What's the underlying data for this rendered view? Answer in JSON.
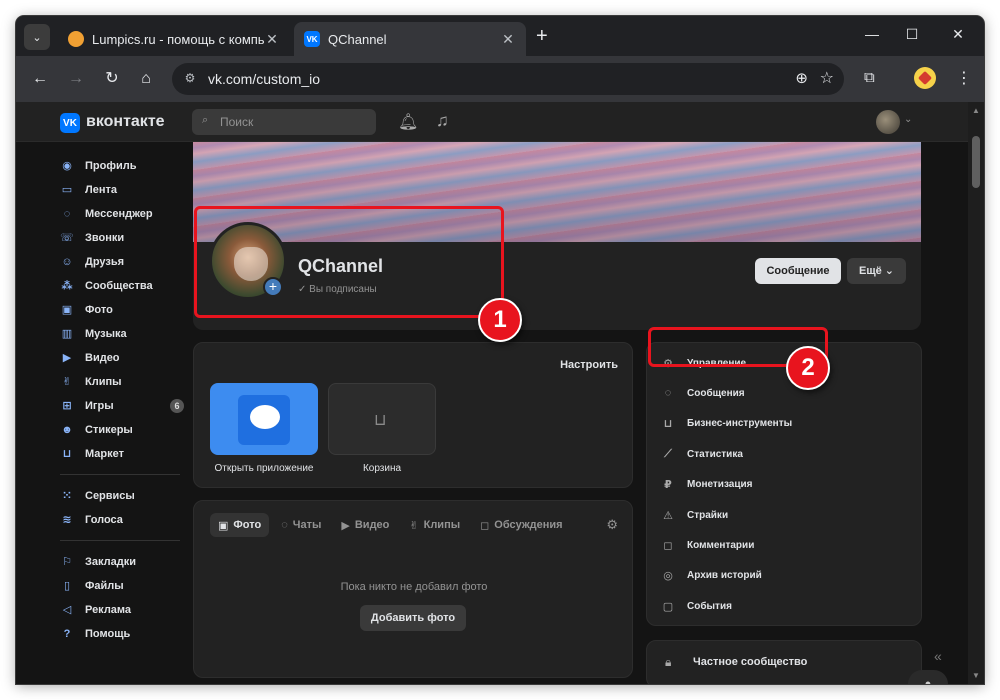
{
  "browser": {
    "tabs": [
      {
        "title": "Lumpics.ru - помощь с компь",
        "active": false
      },
      {
        "title": "QChannel",
        "active": true
      }
    ],
    "url": "vk.com/custom_io",
    "icons": {
      "tab_search": "chevron-down-icon",
      "new_tab": "plus-icon",
      "back": "arrow-left-icon",
      "forward": "arrow-right-icon",
      "reload": "reload-icon",
      "home": "home-icon",
      "zoom": "zoom-icon",
      "bookmark": "star-icon",
      "extensions": "puzzle-icon",
      "menu": "kebab-icon"
    }
  },
  "vk": {
    "brand": "вконтакте",
    "search_placeholder": "Поиск",
    "left_menu": [
      {
        "label": "Профиль",
        "icon": "user-icon"
      },
      {
        "label": "Лента",
        "icon": "feed-icon"
      },
      {
        "label": "Мессенджер",
        "icon": "chat-icon"
      },
      {
        "label": "Звонки",
        "icon": "phone-icon"
      },
      {
        "label": "Друзья",
        "icon": "friends-icon"
      },
      {
        "label": "Сообщества",
        "icon": "communities-icon"
      },
      {
        "label": "Фото",
        "icon": "photo-icon"
      },
      {
        "label": "Музыка",
        "icon": "music-icon"
      },
      {
        "label": "Видео",
        "icon": "video-icon"
      },
      {
        "label": "Клипы",
        "icon": "clips-icon"
      },
      {
        "label": "Игры",
        "icon": "games-icon",
        "badge": "6"
      },
      {
        "label": "Стикеры",
        "icon": "sticker-icon"
      },
      {
        "label": "Маркет",
        "icon": "market-icon"
      }
    ],
    "left_menu_2": [
      {
        "label": "Сервисы",
        "icon": "services-icon"
      },
      {
        "label": "Голоса",
        "icon": "votes-icon"
      }
    ],
    "left_menu_3": [
      {
        "label": "Закладки",
        "icon": "bookmark-icon"
      },
      {
        "label": "Файлы",
        "icon": "file-icon"
      },
      {
        "label": "Реклама",
        "icon": "ads-icon"
      },
      {
        "label": "Помощь",
        "icon": "help-icon"
      }
    ],
    "profile": {
      "name": "QChannel",
      "subscribed": "Вы подписаны",
      "message_button": "Сообщение",
      "more_button": "Ещё"
    },
    "apps": {
      "configure": "Настроить",
      "open_app": "Открыть приложение",
      "cart": "Корзина"
    },
    "photos": {
      "tabs": [
        "Фото",
        "Чаты",
        "Видео",
        "Клипы",
        "Обсуждения"
      ],
      "empty": "Пока никто не добавил фото",
      "add_button": "Добавить фото"
    },
    "management": [
      {
        "label": "Управление",
        "icon": "gear-icon"
      },
      {
        "label": "Сообщения",
        "icon": "chat-icon"
      },
      {
        "label": "Бизнес-инструменты",
        "icon": "bag-icon"
      },
      {
        "label": "Статистика",
        "icon": "chart-icon"
      },
      {
        "label": "Монетизация",
        "icon": "ruble-icon"
      },
      {
        "label": "Страйки",
        "icon": "warning-icon"
      },
      {
        "label": "Комментарии",
        "icon": "comment-icon"
      },
      {
        "label": "Архив историй",
        "icon": "archive-icon"
      },
      {
        "label": "События",
        "icon": "event-icon"
      }
    ],
    "private": "Частное сообщество"
  },
  "annotations": {
    "badge1": "1",
    "badge2": "2",
    "color": "#e8141e"
  }
}
